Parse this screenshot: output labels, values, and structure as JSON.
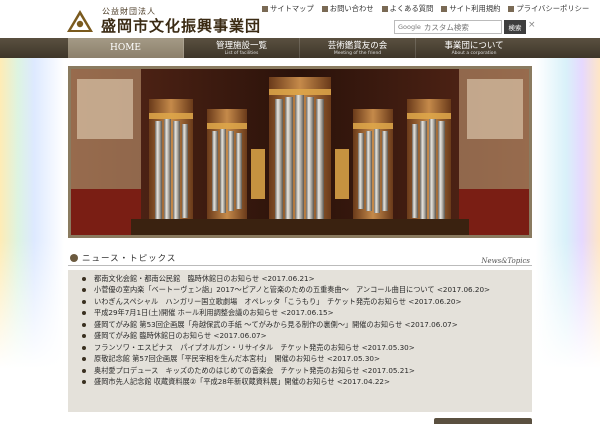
{
  "header": {
    "org_sub": "公益財団法人",
    "org_name": "盛岡市文化振興事業団",
    "top_links": [
      {
        "label": "サイトマップ"
      },
      {
        "label": "お問い合わせ"
      },
      {
        "label": "よくある質問"
      },
      {
        "label": "サイト利用規約"
      },
      {
        "label": "プライバシーポリシー"
      }
    ],
    "search": {
      "google_label": "Google",
      "placeholder": "カスタム検索",
      "button_label": "検索",
      "clear_label": "×"
    }
  },
  "nav": {
    "items": [
      {
        "label": "HOME",
        "sub": ""
      },
      {
        "label": "管理施設一覧",
        "sub": "List of facilities"
      },
      {
        "label": "芸術鑑賞友の会",
        "sub": "Meeting of the friend"
      },
      {
        "label": "事業団について",
        "sub": "About a corporation"
      }
    ]
  },
  "news": {
    "title": "ニュース・トピックス",
    "title_en": "News&Topics",
    "items": [
      {
        "text": "都南文化会館・都南公民館　臨時休館日のお知らせ <2017.06.21>"
      },
      {
        "text": "小菅優の室内楽「ベートーヴェン詣」2017～ピアノと管楽のための五重奏曲～　アンコール曲目について <2017.06.20>"
      },
      {
        "text": "いわぎんスペシャル　ハンガリー国立歌劇場　オペレッタ「こうもり」　チケット発売のお知らせ <2017.06.20>"
      },
      {
        "text": "平成29年7月1日(土)開催 ホール利用調整会議のお知らせ <2017.06.15>"
      },
      {
        "text": "盛岡てがみ館 第53回企画展「舟越保武の手紙 ～てがみから見る制作の裏側～」開催のお知らせ <2017.06.07>"
      },
      {
        "text": "盛岡てがみ館 臨時休館日のお知らせ <2017.06.07>"
      },
      {
        "text": "フランソワ・エスピナス　パイプオルガン・リサイタル　チケット発売のお知らせ <2017.05.30>"
      },
      {
        "text": "原敬記念館 第57回企画展「平民宰相を生んだ本宮村」　開催のお知らせ <2017.05.30>"
      },
      {
        "text": "奥村愛プロデュース　キッズのためのはじめての音楽会　チケット発売のお知らせ <2017.05.21>"
      },
      {
        "text": "盛岡市先人記念館 収蔵資料展②「平成28年新収蔵資料展」開催のお知らせ <2017.04.22>"
      }
    ]
  },
  "colors": {
    "nav_bg": "#3e3629",
    "nav_active": "#8c806b",
    "news_box": "#e4e1da",
    "brand_brown": "#3b2b14"
  }
}
